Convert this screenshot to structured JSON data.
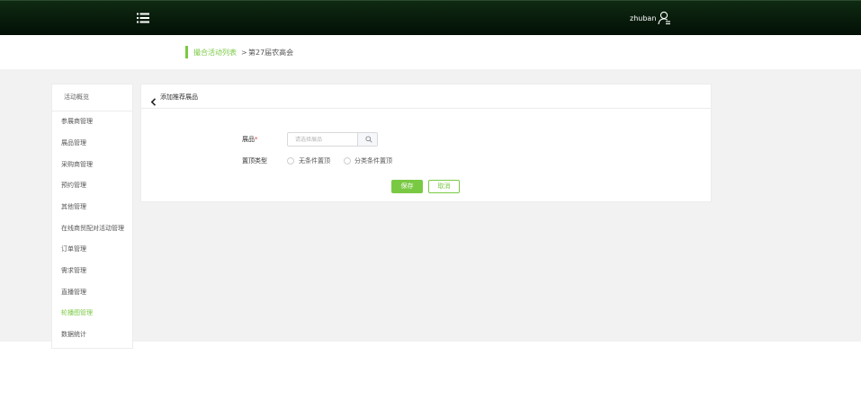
{
  "header": {
    "username": "zhuban",
    "menu_icon": "list-menu-icon",
    "user_icon": "user-icon"
  },
  "breadcrumb": {
    "parent": "撮合活动列表",
    "separator": ">",
    "current": "第27届农高会"
  },
  "sidebar": {
    "title": "活动概览",
    "items": [
      {
        "label": "参展商管理"
      },
      {
        "label": "展品管理"
      },
      {
        "label": "采购商管理"
      },
      {
        "label": "预约管理"
      },
      {
        "label": "其他管理"
      },
      {
        "label": "在线商贸配对活动管理"
      },
      {
        "label": "订单管理"
      },
      {
        "label": "需求管理"
      },
      {
        "label": "直播管理"
      },
      {
        "label": "轮播图管理"
      },
      {
        "label": "数据统计"
      }
    ],
    "active_item": "轮播图管理"
  },
  "panel": {
    "title": "添加推荐展品",
    "back_icon": "chevron-left-icon"
  },
  "form": {
    "product_label": "展品",
    "required_mark": "*",
    "product_placeholder": "请选择展品",
    "search_icon": "search-icon",
    "pin_type_label": "置顶类型",
    "pin_options": [
      {
        "label": "无条件置顶"
      },
      {
        "label": "分类条件置顶"
      }
    ],
    "save_label": "保存",
    "cancel_label": "取消"
  },
  "colors": {
    "accent": "#7ac943",
    "topbar": "#071a0b",
    "content_bg": "#f2f2f2",
    "required": "#e4393c"
  }
}
